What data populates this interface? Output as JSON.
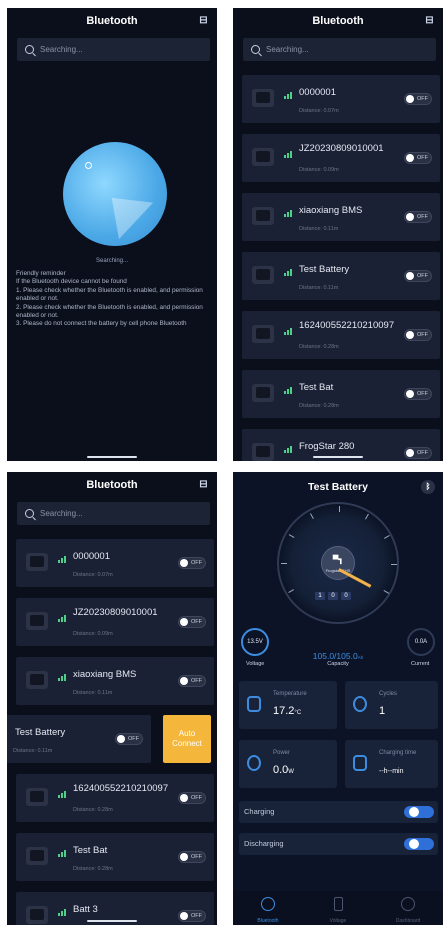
{
  "panel1": {
    "title": "Bluetooth",
    "search_placeholder": "Searching...",
    "status": "Searching...",
    "reminder_lines": [
      "Friendly reminder",
      "If the Bluetooth device cannot be found",
      "1. Please check whether the Bluetooth is enabled, and permission enabled or not.",
      "2. Please check whether the Bluetooth is enabled, and permission enabled or not.",
      "3. Please do not connect the battery by cell phone Bluetooth"
    ]
  },
  "panel2": {
    "title": "Bluetooth",
    "search_placeholder": "Searching...",
    "devices": [
      {
        "name": "0000001",
        "distance": "Distance: 0.07m",
        "toggle": "OFF"
      },
      {
        "name": "JZ20230809010001",
        "distance": "Distance: 0.09m",
        "toggle": "OFF"
      },
      {
        "name": "xiaoxiang BMS",
        "distance": "Distance: 0.11m",
        "toggle": "OFF"
      },
      {
        "name": "Test Battery",
        "distance": "Distance: 0.11m",
        "toggle": "OFF"
      },
      {
        "name": "162400552210210097",
        "distance": "Distance: 0.28m",
        "toggle": "OFF"
      },
      {
        "name": "Test Bat",
        "distance": "Distance: 0.28m",
        "toggle": "OFF"
      },
      {
        "name": "FrogStar 280",
        "distance": "",
        "toggle": "OFF"
      }
    ]
  },
  "panel3": {
    "title": "Bluetooth",
    "search_placeholder": "Searching...",
    "swiped_device": {
      "name": "Test Battery",
      "distance": "Distance: 0.11m",
      "toggle": "OFF",
      "action": "Auto Connect"
    },
    "devices_top": [
      {
        "name": "0000001",
        "distance": "Distance: 0.07m",
        "toggle": "OFF"
      },
      {
        "name": "JZ20230809010001",
        "distance": "Distance: 0.09m",
        "toggle": "OFF"
      },
      {
        "name": "xiaoxiang BMS",
        "distance": "Distance: 0.11m",
        "toggle": "OFF"
      }
    ],
    "devices_bottom": [
      {
        "name": "162400552210210097",
        "distance": "Distance: 0.28m",
        "toggle": "OFF"
      },
      {
        "name": "Test Bat",
        "distance": "Distance: 0.28m",
        "toggle": "OFF"
      },
      {
        "name": "Batt 3",
        "distance": "",
        "toggle": "OFF"
      }
    ]
  },
  "panel4": {
    "title": "Test Battery",
    "brand": "Frogstar GHS",
    "digits": [
      "1",
      "0",
      "0"
    ],
    "voltage": "13.5V",
    "voltage_label": "Voltage",
    "capacity": "105.0/105.0",
    "capacity_unit": "Ah",
    "capacity_label": "Capacity",
    "current": "0.0A",
    "current_label": "Current",
    "temperature_label": "Temperature",
    "temperature": "17.2",
    "temperature_unit": "°C",
    "cycles_label": "Cycles",
    "cycles": "1",
    "power_label": "Power",
    "power": "0.0",
    "power_unit": "W",
    "charging_time_label": "Charging time",
    "charging_time": "--h--min",
    "charging_label": "Charging",
    "charging_state": "ON",
    "discharging_label": "Discharging",
    "discharging_state": "ON",
    "tabs": [
      "Bluetooth",
      "Voltage",
      "Dashboard"
    ]
  }
}
